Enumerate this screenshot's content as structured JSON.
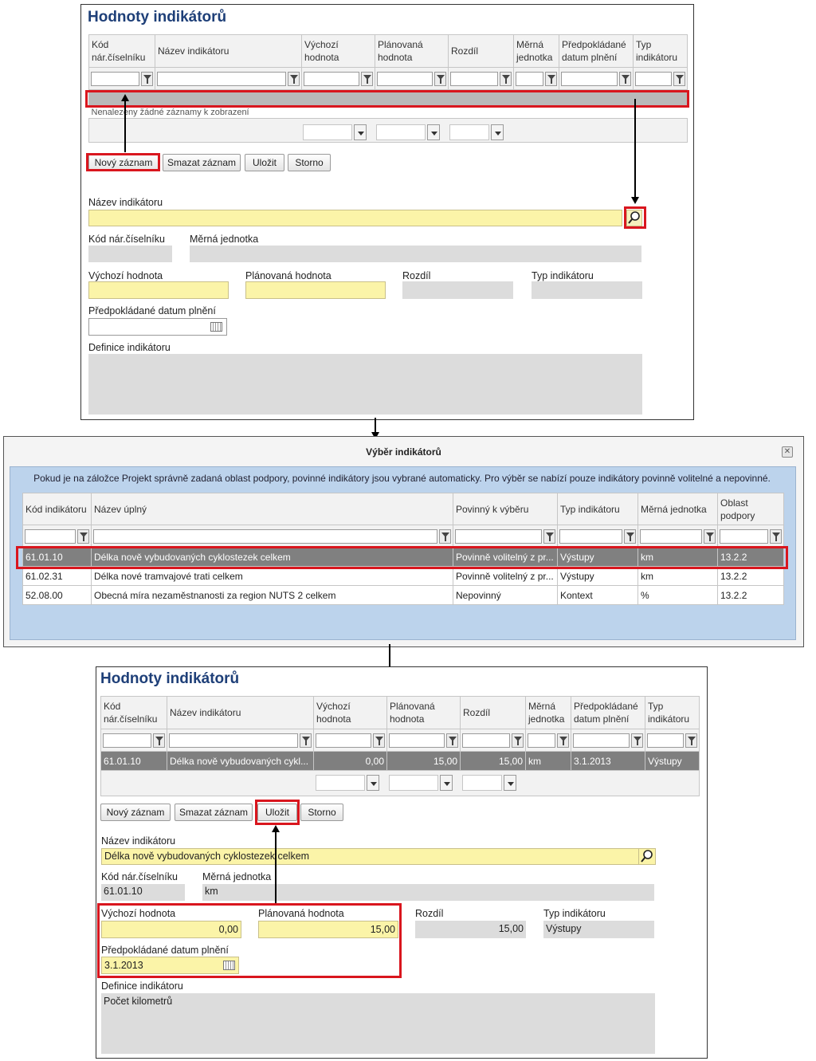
{
  "panel1": {
    "title": "Hodnoty indikátorů",
    "columns": [
      "Kód nár.číselníku",
      "Název indikátoru",
      "Výchozí hodnota",
      "Plánovaná hodnota",
      "Rozdíl",
      "Měrná jednotka",
      "Předpokládané datum plnění",
      "Typ indikátoru"
    ],
    "empty_text": "Nenalezeny žádné záznamy k zobrazení",
    "buttons": {
      "new": "Nový záznam",
      "delete": "Smazat záznam",
      "save": "Uložit",
      "cancel": "Storno"
    },
    "form": {
      "name_label": "Název indikátoru",
      "name_value": "",
      "code_label": "Kód nár.číselníku",
      "code_value": "",
      "unit_label": "Měrná jednotka",
      "unit_value": "",
      "start_label": "Výchozí hodnota",
      "start_value": "",
      "plan_label": "Plánovaná hodnota",
      "plan_value": "",
      "diff_label": "Rozdíl",
      "diff_value": "",
      "type_label": "Typ indikátoru",
      "type_value": "",
      "date_label": "Předpokládané datum plnění",
      "date_value": "",
      "def_label": "Definice indikátoru",
      "def_value": ""
    }
  },
  "dialog": {
    "title": "Výběr indikátorů",
    "info": "Pokud je na záložce Projekt správně zadaná oblast podpory, povinné indikátory jsou vybrané automaticky. Pro výběr se nabízí pouze indikátory povinně volitelné a nepovinné.",
    "columns": [
      "Kód indikátoru",
      "Název úplný",
      "Povinný k výběru",
      "Typ indikátoru",
      "Měrná jednotka",
      "Oblast podpory"
    ],
    "rows": [
      [
        "61.01.10",
        "Délka nově vybudovaných cyklostezek celkem",
        "Povinně volitelný z pr...",
        "Výstupy",
        "km",
        "13.2.2"
      ],
      [
        "61.02.31",
        "Délka nové tramvajové trati celkem",
        "Povinně volitelný z pr...",
        "Výstupy",
        "km",
        "13.2.2"
      ],
      [
        "52.08.00",
        "Obecná míra nezaměstnanosti za region NUTS 2 celkem",
        "Nepovinný",
        "Kontext",
        "%",
        "13.2.2"
      ]
    ]
  },
  "panel2": {
    "title": "Hodnoty indikátorů",
    "columns": [
      "Kód nár.číselníku",
      "Název indikátoru",
      "Výchozí hodnota",
      "Plánovaná hodnota",
      "Rozdíl",
      "Měrná jednotka",
      "Předpokládané datum plnění",
      "Typ indikátoru"
    ],
    "row": [
      "61.01.10",
      "Délka nově vybudovaných cykl...",
      "0,00",
      "15,00",
      "15,00",
      "km",
      "3.1.2013",
      "Výstupy"
    ],
    "buttons": {
      "new": "Nový záznam",
      "delete": "Smazat záznam",
      "save": "Uložit",
      "cancel": "Storno"
    },
    "form": {
      "name_label": "Název indikátoru",
      "name_value": "Délka nově vybudovaných cyklostezek celkem",
      "code_label": "Kód nár.číselníku",
      "code_value": "61.01.10",
      "unit_label": "Měrná jednotka",
      "unit_value": "km",
      "start_label": "Výchozí hodnota",
      "start_value": "0,00",
      "plan_label": "Plánovaná hodnota",
      "plan_value": "15,00",
      "diff_label": "Rozdíl",
      "diff_value": "15,00",
      "type_label": "Typ indikátoru",
      "type_value": "Výstupy",
      "date_label": "Předpokládané datum plnění",
      "date_value": "3.1.2013",
      "def_label": "Definice indikátoru",
      "def_value": "Počet kilometrů"
    }
  },
  "colors": {
    "title": "#1e3f78",
    "highlight": "#d9161e",
    "required_field": "#fbf4a8",
    "readonly_field": "#dcdcdc",
    "dialog_bg": "#bcd3ec",
    "selected_row": "#7f7f7f"
  },
  "icons": [
    "filter-icon",
    "search-icon",
    "calendar-icon",
    "close-icon",
    "dropdown-arrow-icon"
  ]
}
